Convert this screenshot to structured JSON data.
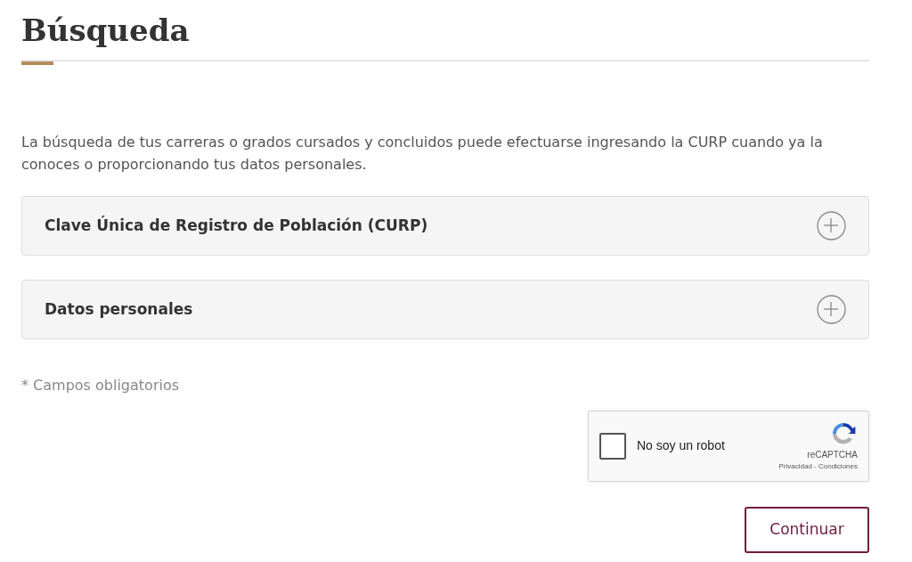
{
  "title": "Búsqueda",
  "intro": "La búsqueda de tus carreras o grados cursados y concluidos puede efectuarse ingresando la CURP cuando ya la conoces o proporcionando tus datos personales.",
  "panels": [
    {
      "label": "Clave Única de Registro de Población (CURP)",
      "expanded": false
    },
    {
      "label": "Datos personales",
      "expanded": false
    }
  ],
  "required_note": "* Campos obligatorios",
  "captcha": {
    "label": "No soy un robot",
    "checked": false,
    "brand": "reCAPTCHA",
    "links": [
      "Privacidad",
      "Condiciones"
    ],
    "separator": "-"
  },
  "submit": "Continuar"
}
